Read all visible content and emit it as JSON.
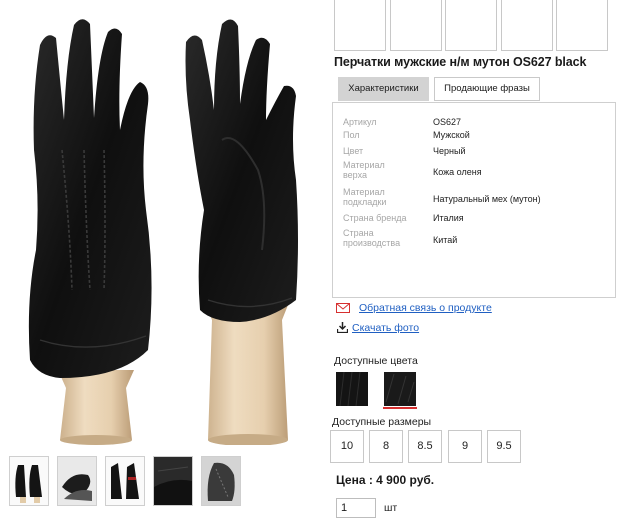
{
  "product": {
    "title": "Перчатки мужские н/м мутон OS627 black",
    "tabs": [
      "Характеристики",
      "Продающие фразы"
    ],
    "specs": [
      {
        "label": "Артикул",
        "value": "OS627"
      },
      {
        "label": "Пол",
        "value": "Мужской"
      },
      {
        "label": "Цвет",
        "value": "Черный"
      },
      {
        "label": "Материал верха",
        "value": "Кожа оленя"
      },
      {
        "label": "Материал подкладки",
        "value": "Натуральный мех (мутон)"
      },
      {
        "label": "Страна бренда",
        "value": "Италия"
      },
      {
        "label": "Страна производства",
        "value": "Китай"
      }
    ],
    "feedback_link": "Обратная связь о продукте",
    "download_link": "Скачать фото",
    "colors_label": "Доступные цвета",
    "sizes_label": "Доступные размеры",
    "sizes": [
      "10",
      "8",
      "8.5",
      "9",
      "9.5"
    ],
    "price": "Цена : 4 900 руб.",
    "quantity": "1",
    "quantity_unit": "шт"
  },
  "colors": {
    "accent_red": "#d63030",
    "link_blue": "#1f5fc2",
    "glove_black": "#141414",
    "stand_wood": "#e8d3b4"
  },
  "icons": {
    "feedback": "mail-icon",
    "download": "download-icon"
  }
}
